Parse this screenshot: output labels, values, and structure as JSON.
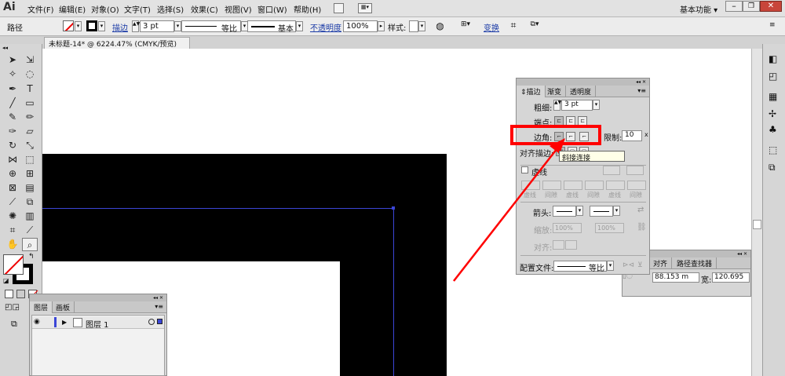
{
  "app": {
    "logo": "Ai",
    "workspace_label": "基本功能 ▾"
  },
  "menu": [
    "文件(F)",
    "编辑(E)",
    "对象(O)",
    "文字(T)",
    "选择(S)",
    "效果(C)",
    "视图(V)",
    "窗口(W)",
    "帮助(H)"
  ],
  "control_bar": {
    "object_type": "路径",
    "stroke_label": "描边",
    "stroke_weight": "3 pt",
    "profile_label": "等比",
    "brush_label": "基本",
    "opacity_label": "不透明度",
    "opacity_value": "100%",
    "style_label": "样式:",
    "transform_label": "变换"
  },
  "document": {
    "tab_title": "未标题-14* @ 6224.47% (CMYK/预览)"
  },
  "stroke_panel": {
    "tabs": [
      "描边",
      "渐变",
      "透明度"
    ],
    "weight_label": "粗细:",
    "weight_value": "3 pt",
    "cap_label": "端点:",
    "corner_label": "边角:",
    "limit_label": "限制:",
    "limit_value": "10",
    "align_label": "对齐描边:",
    "tooltip": "斜接连接",
    "dashed_label": "虚线",
    "dash_fields": [
      "虚线",
      "间隙",
      "虚线",
      "间隙",
      "虚线",
      "间隙"
    ],
    "arrow_label": "箭头:",
    "scale_label": "缩放:",
    "scale_values": [
      "100%",
      "100%"
    ],
    "align2_label": "对齐:",
    "profile_label": "配置文件:",
    "profile_value": "等比"
  },
  "align_panel": {
    "tabs": [
      "对齐",
      "路径查找器"
    ],
    "x_value": "88.153 m",
    "width_label": "宽:",
    "width_value": "120.695"
  },
  "layers_panel": {
    "tabs": [
      "图层",
      "画板"
    ],
    "layer_name": "图层 1"
  },
  "colors": {
    "highlight": "#ff0000",
    "selection": "#3b46d6",
    "shape": "#000000"
  }
}
